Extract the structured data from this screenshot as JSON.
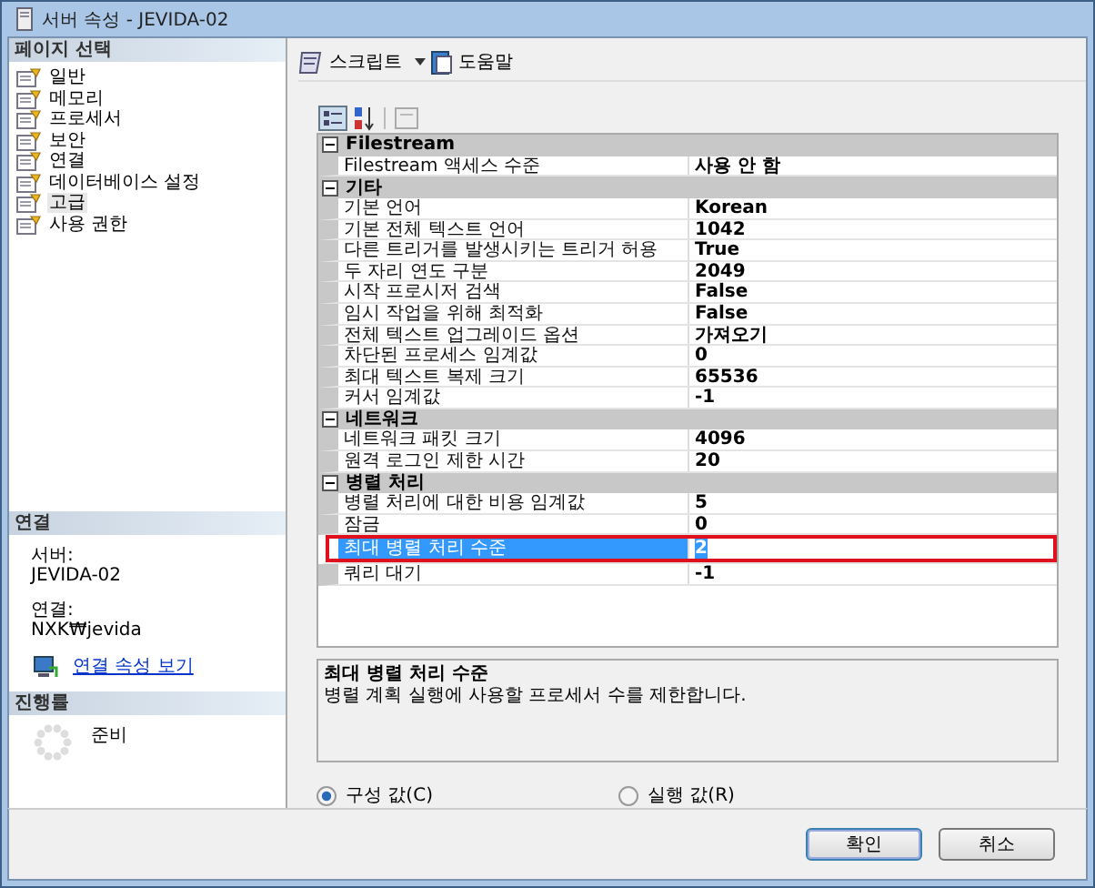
{
  "window": {
    "title": "서버 속성 - JEVIDA-02"
  },
  "sidebar": {
    "header": "페이지 선택",
    "items": [
      {
        "label": "일반",
        "selected": false
      },
      {
        "label": "메모리",
        "selected": false
      },
      {
        "label": "프로세서",
        "selected": false
      },
      {
        "label": "보안",
        "selected": false
      },
      {
        "label": "연결",
        "selected": false
      },
      {
        "label": "데이터베이스 설정",
        "selected": false
      },
      {
        "label": "고급",
        "selected": true
      },
      {
        "label": "사용 권한",
        "selected": false
      }
    ]
  },
  "connection": {
    "header": "연결",
    "server_label": "서버:",
    "server": "JEVIDA-02",
    "connection_label": "연결:",
    "connection": "NXK₩jevida",
    "link": "연결 속성 보기"
  },
  "progress": {
    "header": "진행률",
    "status": "준비"
  },
  "toolbar": {
    "script": "스크립트",
    "help": "도움말"
  },
  "grid": {
    "categories": [
      {
        "name": "Filestream",
        "expanded": true,
        "rows": [
          {
            "name": "Filestream 액세스 수준",
            "value": "사용 안 함",
            "selected": false
          }
        ]
      },
      {
        "name": "기타",
        "expanded": true,
        "rows": [
          {
            "name": "기본 언어",
            "value": "Korean",
            "selected": false
          },
          {
            "name": "기본 전체 텍스트 언어",
            "value": "1042",
            "selected": false
          },
          {
            "name": "다른 트리거를 발생시키는 트리거 허용",
            "value": "True",
            "selected": false
          },
          {
            "name": "두 자리 연도 구분",
            "value": "2049",
            "selected": false
          },
          {
            "name": "시작 프로시저 검색",
            "value": "False",
            "selected": false
          },
          {
            "name": "임시 작업을 위해 최적화",
            "value": "False",
            "selected": false
          },
          {
            "name": "전체 텍스트 업그레이드 옵션",
            "value": "가져오기",
            "selected": false
          },
          {
            "name": "차단된 프로세스 임계값",
            "value": "0",
            "selected": false
          },
          {
            "name": "최대 텍스트 복제 크기",
            "value": "65536",
            "selected": false
          },
          {
            "name": "커서 임계값",
            "value": "-1",
            "selected": false
          }
        ]
      },
      {
        "name": "네트워크",
        "expanded": true,
        "rows": [
          {
            "name": "네트워크 패킷 크기",
            "value": "4096",
            "selected": false
          },
          {
            "name": "원격 로그인 제한 시간",
            "value": "20",
            "selected": false
          }
        ]
      },
      {
        "name": "병렬 처리",
        "expanded": true,
        "rows": [
          {
            "name": "병렬 처리에 대한 비용 임계값",
            "value": "5",
            "selected": false
          },
          {
            "name": "잠금",
            "value": "0",
            "selected": false
          },
          {
            "name": "최대 병렬 처리 수준",
            "value": "2",
            "selected": true
          },
          {
            "name": "쿼리 대기",
            "value": "-1",
            "selected": false
          }
        ]
      }
    ]
  },
  "description": {
    "title": "최대 병렬 처리 수준",
    "text": "병렬 계획 실행에 사용할 프로세서 수를 제한합니다."
  },
  "radios": [
    {
      "label": "구성 값(C)",
      "selected": true
    },
    {
      "label": "실행 값(R)",
      "selected": false
    }
  ],
  "buttons": [
    "확인",
    "취소"
  ]
}
